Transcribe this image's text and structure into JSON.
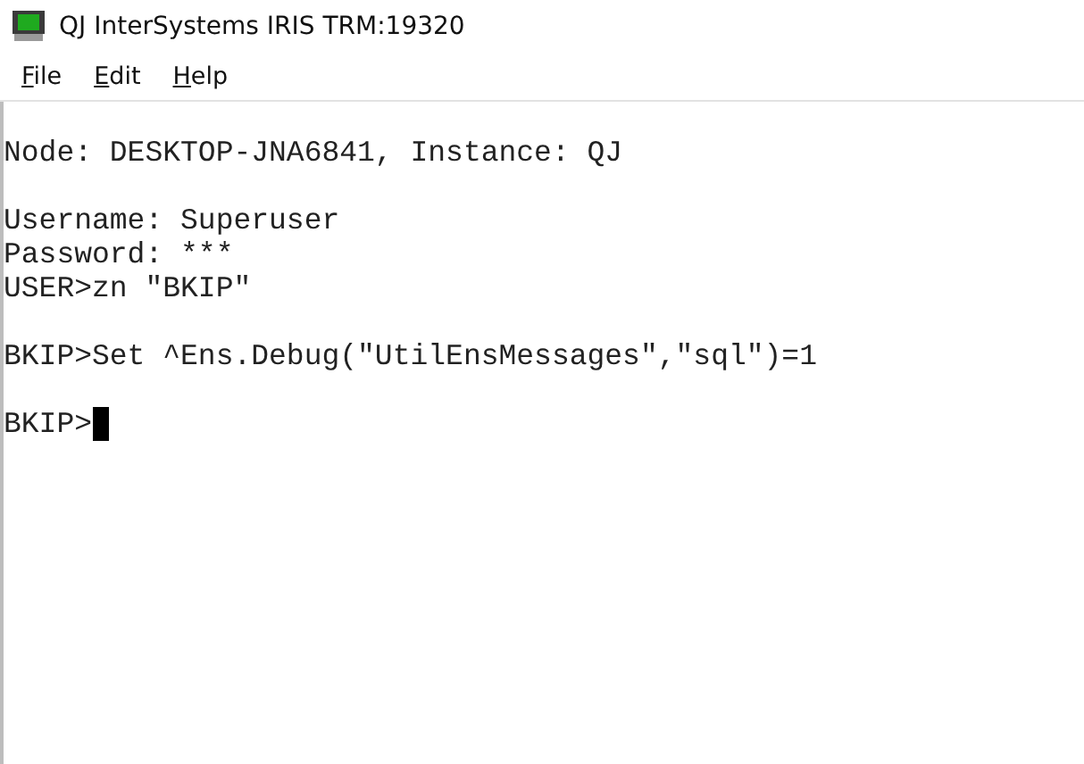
{
  "window": {
    "title": "QJ InterSystems IRIS TRM:19320"
  },
  "menu": [
    "File",
    "Edit",
    "Help"
  ],
  "terminal": {
    "blocks": [
      [
        "Node: DESKTOP-JNA6841, Instance: QJ"
      ],
      [
        "Username: Superuser",
        "Password: ***",
        "USER>zn \"BKIP\""
      ],
      [
        "BKIP>Set ^Ens.Debug(\"UtilEnsMessages\",\"sql\")=1"
      ],
      [
        "BKIP>"
      ]
    ],
    "cursor_visible": true
  }
}
